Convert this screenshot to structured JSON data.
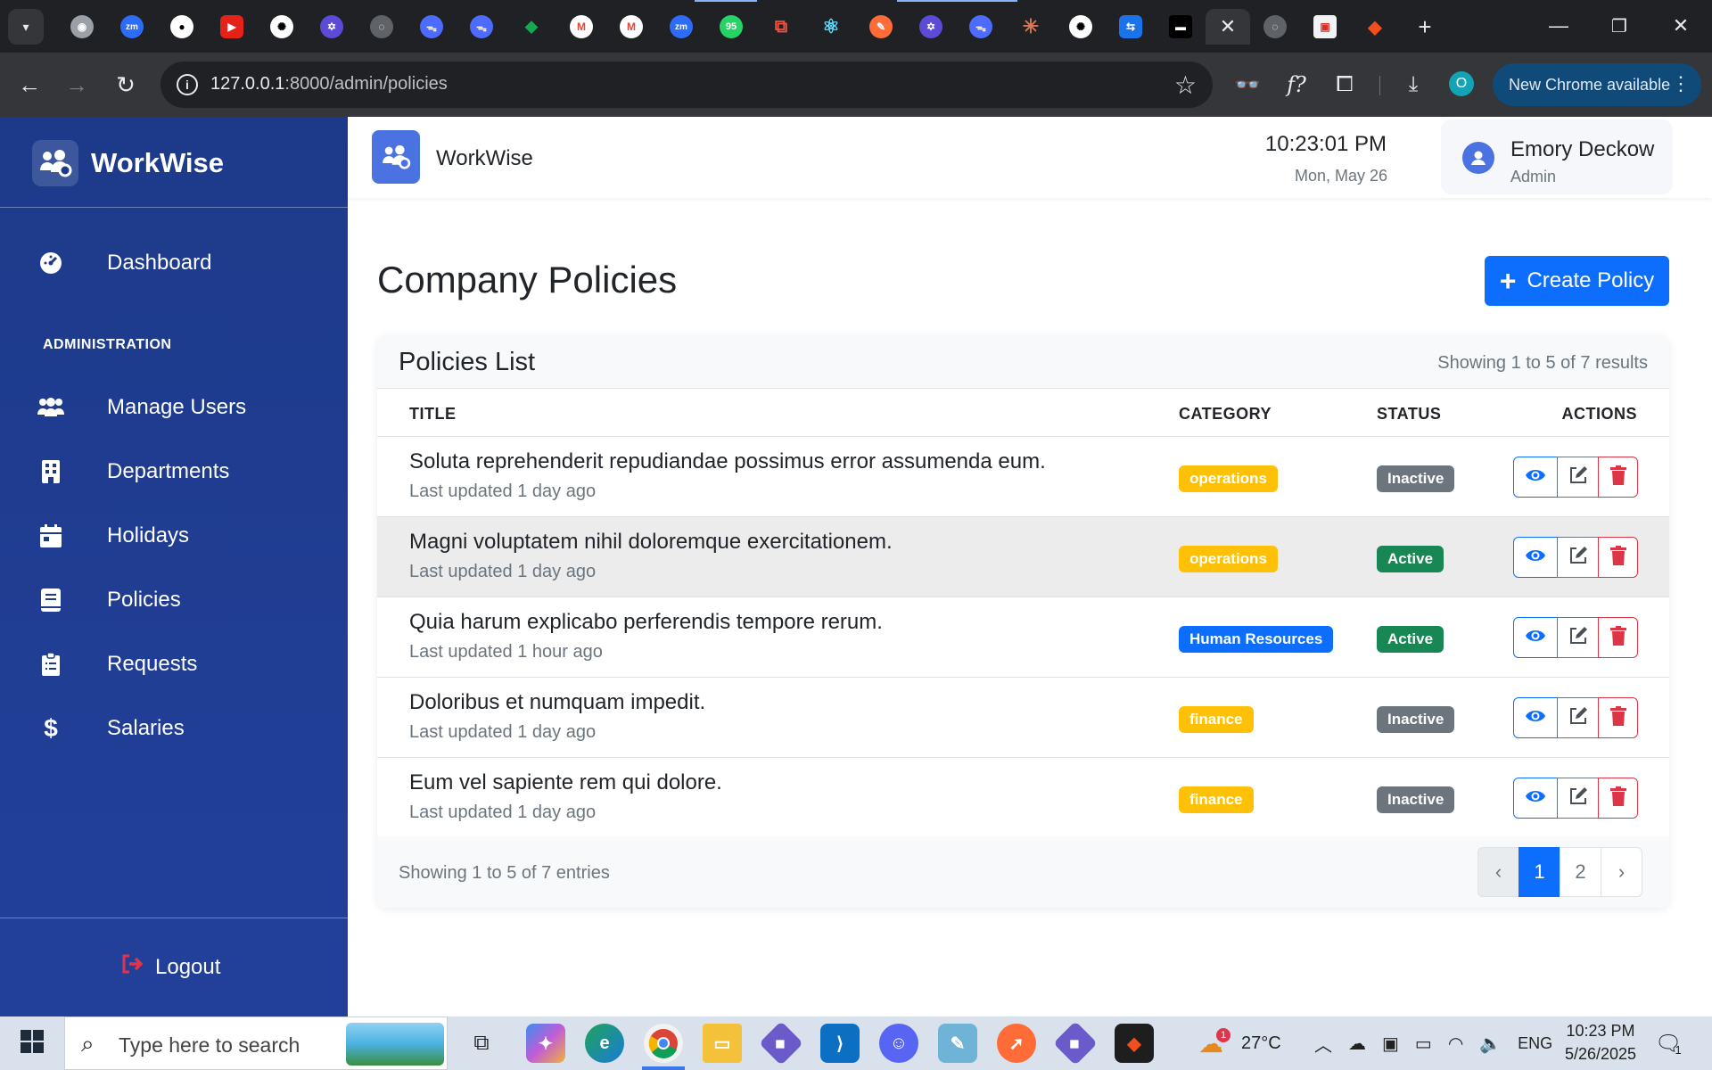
{
  "browser": {
    "url_host": "127.0.0.1",
    "url_path": ":8000/admin/policies",
    "update_label": "New Chrome available",
    "profile_initial": "O",
    "tab_close": "✕"
  },
  "sidebar": {
    "brand": "WorkWise",
    "section_label": "ADMINISTRATION",
    "items": [
      {
        "label": "Dashboard",
        "icon": "gauge-icon"
      },
      {
        "label": "Manage Users",
        "icon": "users-icon"
      },
      {
        "label": "Departments",
        "icon": "building-icon"
      },
      {
        "label": "Holidays",
        "icon": "calendar-icon"
      },
      {
        "label": "Policies",
        "icon": "book-icon"
      },
      {
        "label": "Requests",
        "icon": "clipboard-icon"
      },
      {
        "label": "Salaries",
        "icon": "dollar-icon"
      }
    ],
    "logout": "Logout"
  },
  "header": {
    "brand": "WorkWise",
    "time": "10:23:01 PM",
    "date": "Mon, May 26",
    "user_name": "Emory Deckow",
    "user_role": "Admin"
  },
  "main": {
    "title": "Company Policies",
    "create_label": "Create Policy",
    "card_title": "Policies List",
    "card_count": "Showing 1 to 5 of 7 results",
    "columns": {
      "title": "TITLE",
      "category": "CATEGORY",
      "status": "STATUS",
      "actions": "ACTIONS"
    },
    "rows": [
      {
        "title": "Soluta reprehenderit repudiandae possimus error assumenda eum.",
        "updated": "Last updated 1 day ago",
        "category": "operations",
        "status": "Inactive"
      },
      {
        "title": "Magni voluptatem nihil doloremque exercitationem.",
        "updated": "Last updated 1 day ago",
        "category": "operations",
        "status": "Active"
      },
      {
        "title": "Quia harum explicabo perferendis tempore rerum.",
        "updated": "Last updated 1 hour ago",
        "category": "Human Resources",
        "status": "Active"
      },
      {
        "title": "Doloribus et numquam impedit.",
        "updated": "Last updated 1 day ago",
        "category": "finance",
        "status": "Inactive"
      },
      {
        "title": "Eum vel sapiente rem qui dolore.",
        "updated": "Last updated 1 day ago",
        "category": "finance",
        "status": "Inactive"
      }
    ],
    "footer_text": "Showing 1 to 5 of 7 entries",
    "pager": {
      "prev": "‹",
      "pages": [
        "1",
        "2"
      ],
      "next": "›",
      "current": "1"
    }
  },
  "colors": {
    "sidebar": "#1d3a8a",
    "primary": "#0d6efd",
    "warning": "#ffc107",
    "success": "#198754",
    "secondary": "#6c757d",
    "danger": "#dc3545"
  },
  "taskbar": {
    "search_placeholder": "Type here to search",
    "weather": "27°C",
    "weather_badge": "1",
    "lang": "ENG",
    "time": "10:23 PM",
    "date": "5/26/2025",
    "notif_count": "1"
  }
}
